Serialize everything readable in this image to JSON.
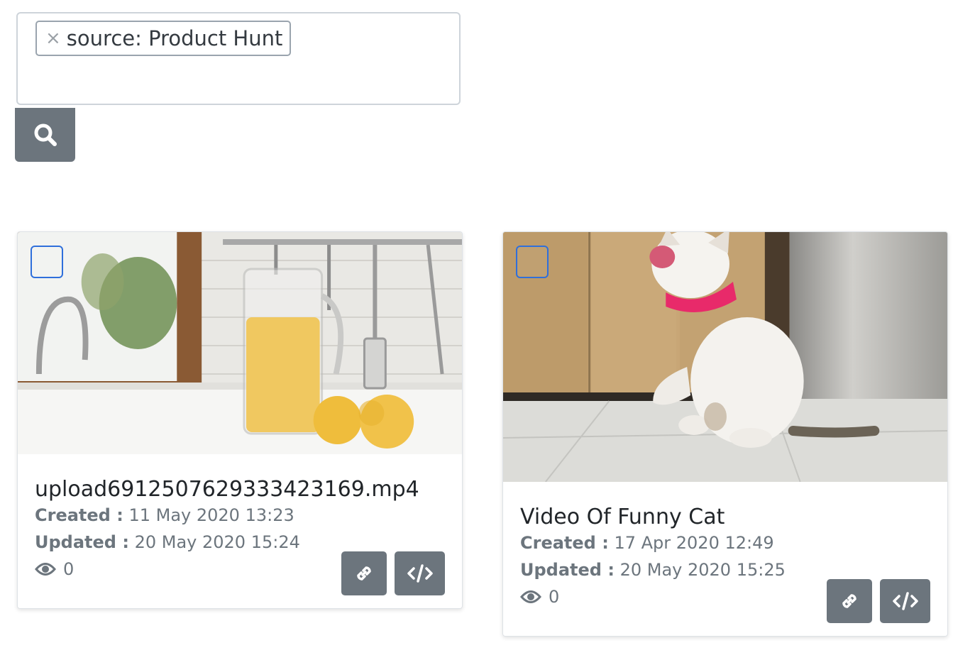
{
  "search": {
    "tag_label": "source: Product Hunt",
    "tag_remove_glyph": "×",
    "search_icon": "search-icon"
  },
  "cards": [
    {
      "title": "upload6912507629333423169.mp4",
      "created_label": "Created :",
      "created_value": "11 May 2020 13:23",
      "updated_label": "Updated :",
      "updated_value": "20 May 2020 15:24",
      "views": "0",
      "thumbnail": "kitchen-juice-pitcher-image",
      "actions": [
        "link-icon",
        "code-icon"
      ]
    },
    {
      "title": "Video Of Funny Cat",
      "created_label": "Created :",
      "created_value": "17 Apr 2020 12:49",
      "updated_label": "Updated :",
      "updated_value": "20 May 2020 15:25",
      "views": "0",
      "thumbnail": "funny-cat-image",
      "actions": [
        "link-icon",
        "code-icon"
      ]
    }
  ],
  "colors": {
    "button_bg": "#6c757d",
    "select_border": "#2f6fdb",
    "text_muted": "#6c757d"
  }
}
